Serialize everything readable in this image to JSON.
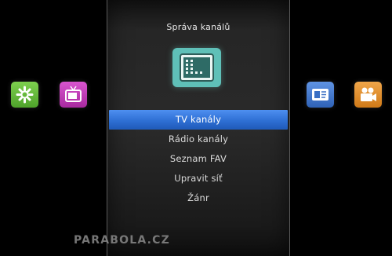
{
  "panel": {
    "title": "Správa kanálů",
    "center_icon": "channel-list-icon"
  },
  "menu": {
    "selected_index": 0,
    "items": [
      {
        "label": "TV kanály"
      },
      {
        "label": "Rádio kanály"
      },
      {
        "label": "Seznam FAV"
      },
      {
        "label": "Upravit síť"
      },
      {
        "label": "Žánr"
      }
    ]
  },
  "side_icons": {
    "left": [
      {
        "name": "tools-icon",
        "color": "#5fb83a"
      },
      {
        "name": "tv-icon",
        "color": "#c23ab8"
      }
    ],
    "right": [
      {
        "name": "info-card-icon",
        "color": "#3a6fc4"
      },
      {
        "name": "media-player-icon",
        "color": "#e0912a"
      }
    ]
  },
  "colors": {
    "selection": "#2e6fd4",
    "panel_bg": "#262626"
  },
  "watermark": "PARABOLA.CZ"
}
